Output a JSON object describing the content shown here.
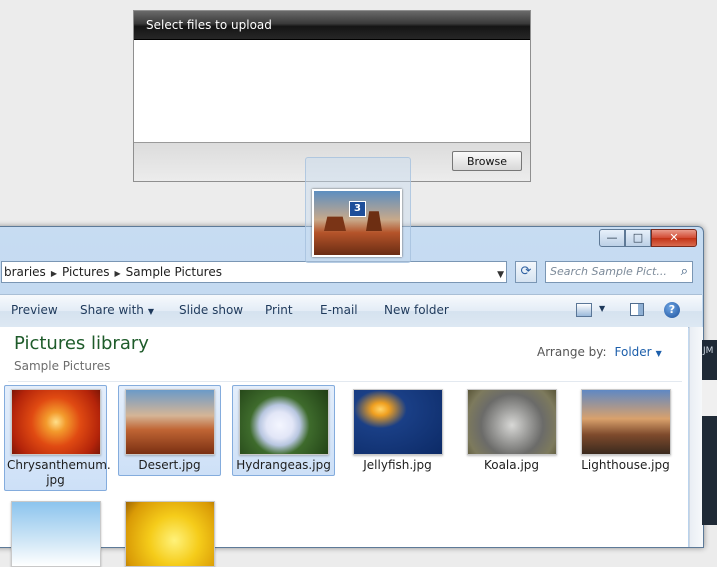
{
  "upload": {
    "header": "Select files to upload",
    "browse_label": "Browse"
  },
  "drag": {
    "count": "3"
  },
  "explorer": {
    "window_controls": {
      "minimize": "—",
      "maximize": "□",
      "close": "✕"
    },
    "breadcrumbs": [
      "braries",
      "Pictures",
      "Sample Pictures"
    ],
    "search_placeholder": "Search Sample Pict...",
    "toolbar": {
      "preview": "Preview",
      "share_with": "Share with",
      "slide_show": "Slide show",
      "print": "Print",
      "email": "E-mail",
      "new_folder": "New folder"
    },
    "library": {
      "title": "Pictures library",
      "subtitle": "Sample Pictures",
      "arrange_label": "Arrange by:",
      "arrange_value": "Folder"
    },
    "files": [
      {
        "name": "Chrysanthemum.\njpg",
        "selected": true,
        "icon": "chrysanthemum-thumbnail"
      },
      {
        "name": "Desert.jpg",
        "selected": true,
        "icon": "desert-thumbnail"
      },
      {
        "name": "Hydrangeas.jpg",
        "selected": true,
        "icon": "hydrangeas-thumbnail"
      },
      {
        "name": "Jellyfish.jpg",
        "selected": false,
        "icon": "jellyfish-thumbnail"
      },
      {
        "name": "Koala.jpg",
        "selected": false,
        "icon": "koala-thumbnail"
      },
      {
        "name": "Lighthouse.jpg",
        "selected": false,
        "icon": "lighthouse-thumbnail"
      },
      {
        "name": "",
        "selected": false,
        "icon": "penguins-thumbnail"
      },
      {
        "name": "",
        "selected": false,
        "icon": "tulips-thumbnail"
      }
    ]
  },
  "background_peek": {
    "text": "JM"
  }
}
